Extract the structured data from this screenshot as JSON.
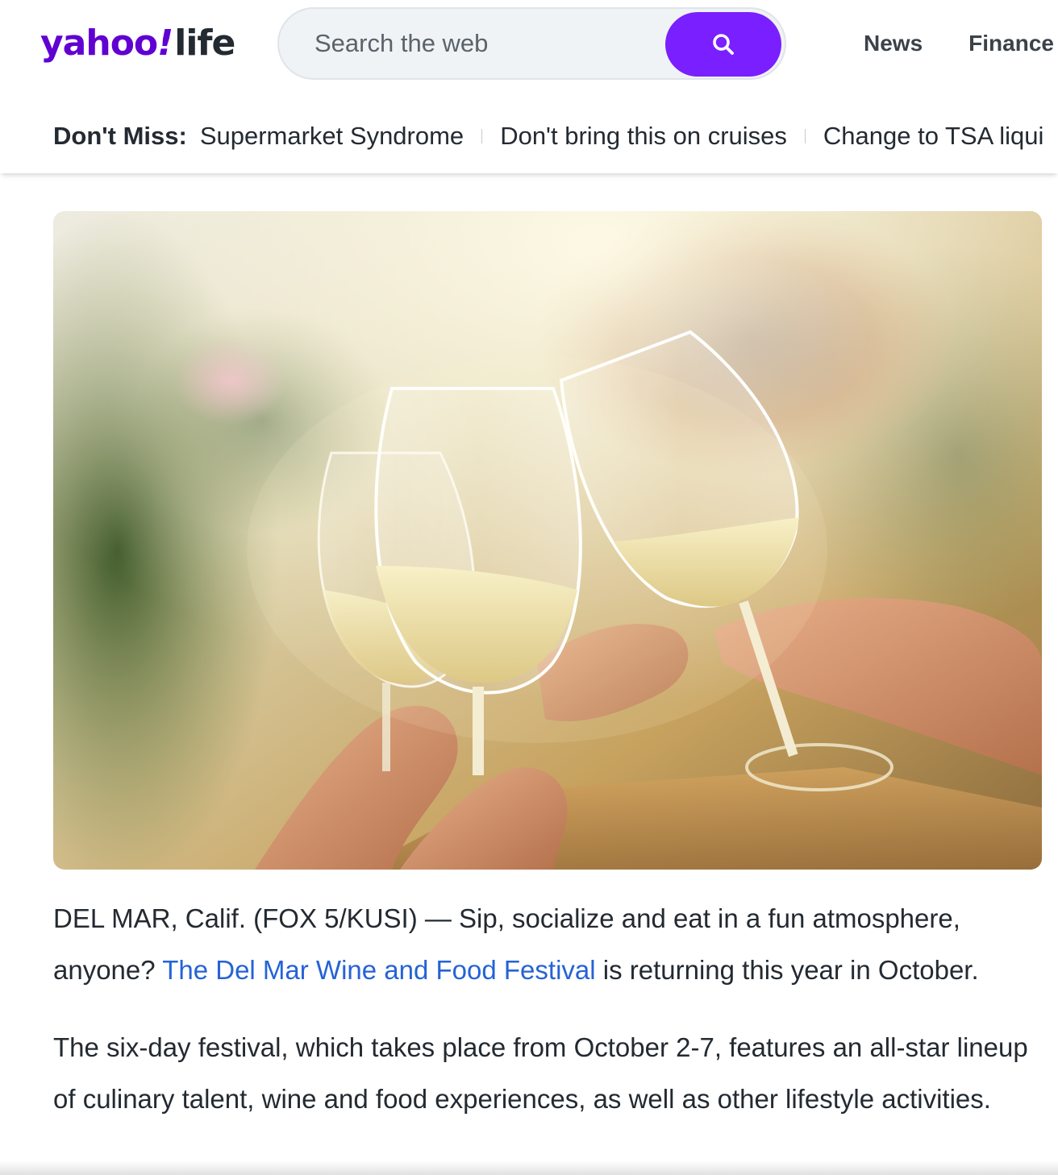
{
  "logo": {
    "brand": "yahoo",
    "bang": "!",
    "section": "life"
  },
  "search": {
    "placeholder": "Search the web",
    "value": "",
    "button_icon": "search-icon"
  },
  "topnav": {
    "items": [
      "News",
      "Finance"
    ]
  },
  "dont_miss": {
    "label": "Don't Miss:",
    "links": [
      "Supermarket Syndrome",
      "Don't bring this on cruises",
      "Change to TSA liqui"
    ]
  },
  "hero": {
    "alt": ""
  },
  "article": {
    "p1_intro": "DEL MAR, Calif. (FOX 5/KUSI) — Sip, socialize and eat in a fun atmosphere, anyone? ",
    "p1_link": "The Del Mar Wine and Food Festival",
    "p1_end": " is returning this year in October.",
    "p2": "The six-day festival, which takes place from October 2-7, features an all-star lineup of culinary talent, wine and food experiences, as well as other lifestyle activities."
  },
  "colors": {
    "brand": "#6001d2",
    "search_button": "#7a1fff",
    "link": "#2563d6",
    "text": "#232a31"
  }
}
